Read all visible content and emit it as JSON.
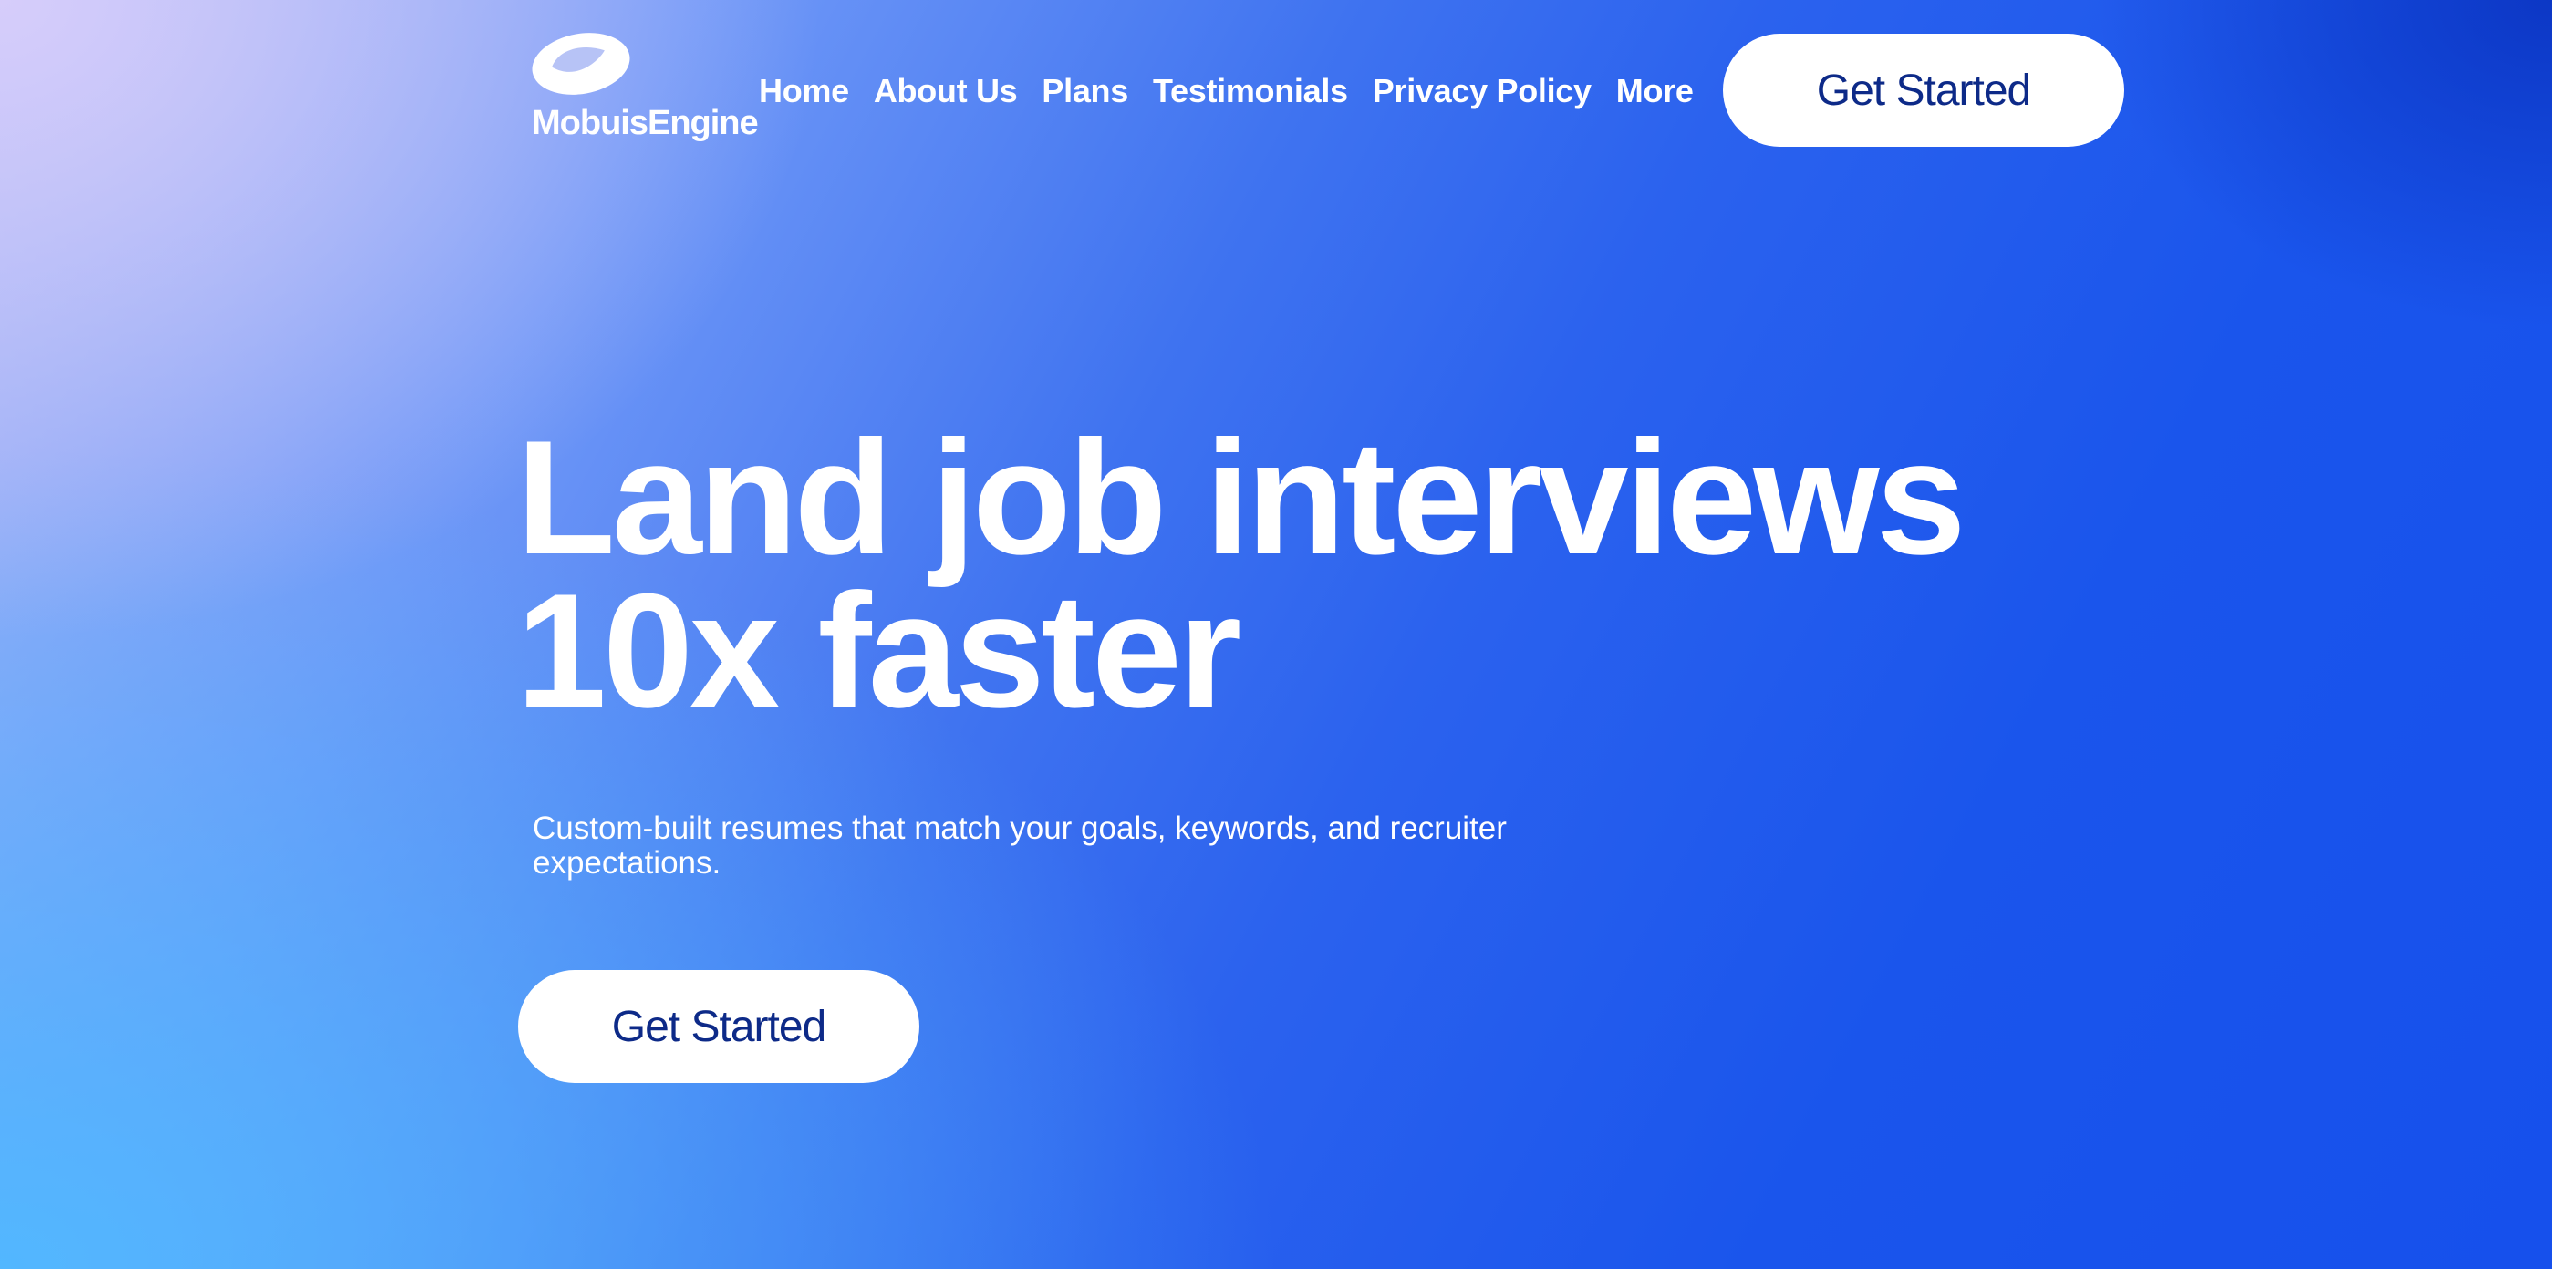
{
  "brand": {
    "name": "MobuisEngine",
    "logo_icon": "mobius-ring-icon"
  },
  "nav": {
    "items": [
      {
        "label": "Home"
      },
      {
        "label": "About Us"
      },
      {
        "label": "Plans"
      },
      {
        "label": "Testimonials"
      },
      {
        "label": "Privacy Policy"
      },
      {
        "label": "More"
      }
    ],
    "cta_label": "Get Started"
  },
  "hero": {
    "title_line1": "Land job interviews",
    "title_line2": "10x faster",
    "subtitle_line1": "Custom-built resumes that match your goals, keywords, and recruiter",
    "subtitle_line2": "expectations.",
    "cta_label": "Get Started"
  },
  "colors": {
    "button_bg": "#ffffff",
    "button_text": "#0d2a88",
    "text_primary": "#ffffff",
    "background_start": "#d6cdfa",
    "background_end": "#1650ec"
  }
}
